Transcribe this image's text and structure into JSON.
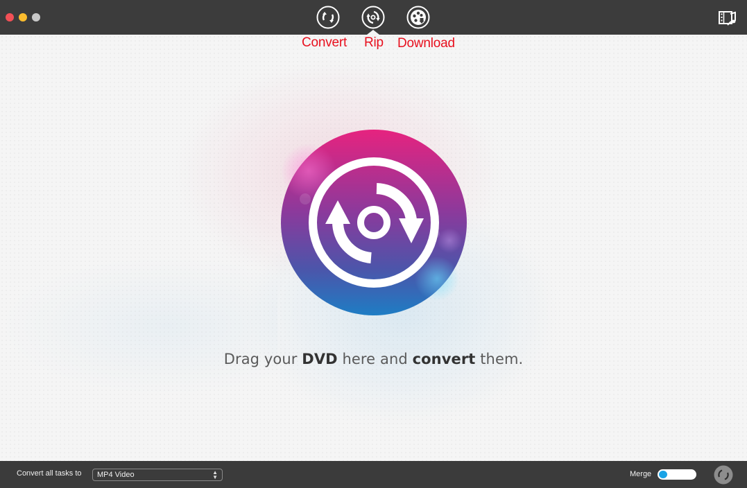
{
  "window": {
    "traffic_lights": [
      "close",
      "minimize",
      "maximize"
    ]
  },
  "toolbar": {
    "tabs": [
      {
        "id": "convert",
        "label": "Convert",
        "icon": "convert-arrows-icon",
        "active": false
      },
      {
        "id": "rip",
        "label": "Rip",
        "icon": "disc-rip-icon",
        "active": true
      },
      {
        "id": "download",
        "label": "Download",
        "icon": "film-reel-download-icon",
        "active": false
      }
    ],
    "media_browser_icon": "film-music-icon"
  },
  "main": {
    "hero_icon": "disc-rip-icon",
    "prompt": {
      "part1": "Drag your ",
      "bold1": "DVD",
      "part2": " here and ",
      "bold2": "convert",
      "part3": " them."
    }
  },
  "bottom_bar": {
    "convert_all_label": "Convert all tasks to",
    "format_value": "MP4 Video",
    "merge_label": "Merge",
    "merge_enabled": false,
    "run_icon": "convert-run-icon"
  },
  "colors": {
    "toolbar_bg": "#3c3c3c",
    "tab_label": "#e8101e",
    "hero_gradient_top": "#e6237f",
    "hero_gradient_mid": "#8a3a9c",
    "hero_gradient_bottom": "#1e7dc4",
    "toggle_knob": "#1aa3e6"
  }
}
